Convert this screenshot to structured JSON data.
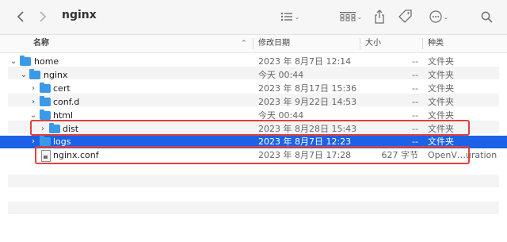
{
  "window": {
    "title": "nginx"
  },
  "toolbar": {
    "back_icon": "chevron-left-icon",
    "forward_icon": "chevron-right-icon",
    "view_icon": "list-view-icon",
    "group_icon": "group-grid-icon",
    "share_icon": "share-icon",
    "tag_icon": "tag-icon",
    "more_icon": "ellipsis-circle-icon",
    "search_icon": "search-icon"
  },
  "columns": {
    "name": "名称",
    "date": "修改日期",
    "size": "大小",
    "kind": "种类"
  },
  "rows": [
    {
      "name": "home",
      "date": "2023 年 8月7日 12:14",
      "size": "--",
      "kind": "文件夹"
    },
    {
      "name": "nginx",
      "date": "今天 00:44",
      "size": "--",
      "kind": "文件夹"
    },
    {
      "name": "cert",
      "date": "2023 年 8月17日 15:36",
      "size": "--",
      "kind": "文件夹"
    },
    {
      "name": "conf.d",
      "date": "2023 年 9月22日 14:53",
      "size": "--",
      "kind": "文件夹"
    },
    {
      "name": "html",
      "date": "今天 00:44",
      "size": "--",
      "kind": "文件夹"
    },
    {
      "name": "dist",
      "date": "2023 年 8月28日 15:43",
      "size": "--",
      "kind": "文件夹"
    },
    {
      "name": "logs",
      "date": "2023 年 8月7日 12:23",
      "size": "--",
      "kind": "文件夹"
    },
    {
      "name": "nginx.conf",
      "date": "2023 年 8月7日 17:28",
      "size": "627 字节",
      "kind": "OpenV…uration"
    }
  ],
  "colors": {
    "selection": "#1d62e6",
    "folder": "#3b9ae8",
    "highlight": "#e4403a"
  }
}
